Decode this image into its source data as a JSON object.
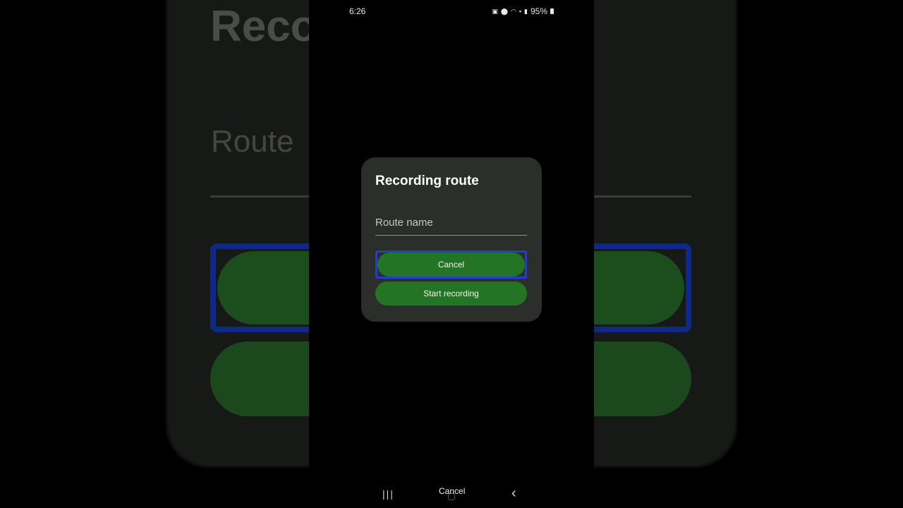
{
  "status_bar": {
    "time": "6:26",
    "battery": "95%",
    "icons": [
      "sync-icon",
      "location-icon",
      "wifi-icon",
      "volte-icon",
      "signal-icon",
      "battery-icon"
    ]
  },
  "background": {
    "title": "Reco",
    "route": "Route"
  },
  "dialog": {
    "title": "Recording route",
    "route_name_placeholder": "Route name",
    "cancel_label": "Cancel",
    "start_label": "Start recording"
  },
  "nav_bar": {
    "recents": "|||",
    "home_label": "Cancel",
    "back": "‹"
  },
  "colors": {
    "dialog_bg": "#2b2e2a",
    "button_green": "#247426",
    "focus_blue": "#1f3fd4"
  }
}
